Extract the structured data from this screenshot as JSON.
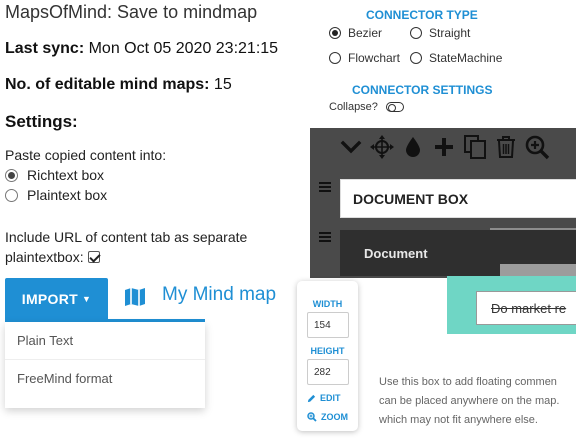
{
  "app": {
    "title": "MapsOfMind: Save to mindmap"
  },
  "status": {
    "last_sync_label": "Last sync:",
    "last_sync_value": "Mon Oct 05 2020 23:21:15",
    "maps_label": "No. of editable mind maps:",
    "maps_value": "15"
  },
  "settings": {
    "heading": "Settings:",
    "paste_label": "Paste copied content into:",
    "paste_options": [
      {
        "label": "Richtext box",
        "selected": true
      },
      {
        "label": "Plaintext box",
        "selected": false
      }
    ],
    "include_url_label": "Include URL of content tab as separate plaintextbox:",
    "include_url_checked": true
  },
  "import": {
    "button_label": "IMPORT",
    "tab_label": "My Mind map",
    "menu_items": [
      "Plain Text",
      "FreeMind format"
    ]
  },
  "connector": {
    "type_heading": "CONNECTOR TYPE",
    "types": [
      {
        "label": "Bezier",
        "selected": true
      },
      {
        "label": "Straight",
        "selected": false
      },
      {
        "label": "Flowchart",
        "selected": false
      },
      {
        "label": "StateMachine",
        "selected": false
      }
    ],
    "settings_heading": "CONNECTOR SETTINGS",
    "collapse_label": "Collapse?"
  },
  "toolbar": {
    "icons": [
      "chevron-down-icon",
      "move-icon",
      "drop-icon",
      "plus-icon",
      "copy-icon",
      "trash-icon",
      "zoom-in-icon"
    ]
  },
  "board": {
    "document_box_label": "DOCUMENT BOX",
    "document_item_label": "Document",
    "node_text": "Do market re",
    "floating_help": [
      "Use this box to add floating commen",
      "can be placed anywhere on the map.",
      "which may not fit anywhere else."
    ]
  },
  "size_panel": {
    "width_label": "WIDTH",
    "width_value": "154",
    "height_label": "HEIGHT",
    "height_value": "282",
    "edit_label": "EDIT",
    "zoom_label": "ZOOM"
  },
  "colors": {
    "accent": "#1f8fd4",
    "board_dark": "#4a4a4a",
    "node_teal": "#6fd6c5"
  }
}
